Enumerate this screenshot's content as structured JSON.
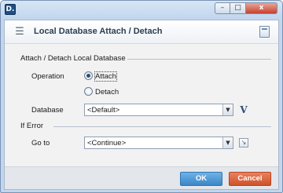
{
  "window": {
    "app_icon_text": "D.",
    "minimize_glyph": "–",
    "maximize_glyph": "□",
    "close_glyph": "x"
  },
  "header": {
    "title": "Local Database Attach / Detach",
    "icon": "database-icon",
    "help_icon": "help-icon"
  },
  "sections": {
    "attach_detach": {
      "title": "Attach / Detach Local Database",
      "operation_label": "Operation",
      "options": [
        {
          "label": "Attach",
          "selected": true
        },
        {
          "label": "Detach",
          "selected": false
        }
      ],
      "database_label": "Database",
      "database_value": "<Default>",
      "variable_button": "V"
    },
    "if_error": {
      "title": "If Error",
      "goto_label": "Go to",
      "goto_value": "<Continue>"
    }
  },
  "footer": {
    "ok_label": "OK",
    "cancel_label": "Cancel"
  },
  "colors": {
    "ok": "#4a95d4",
    "cancel": "#de6a43",
    "title_bar": "#c8daf0"
  }
}
